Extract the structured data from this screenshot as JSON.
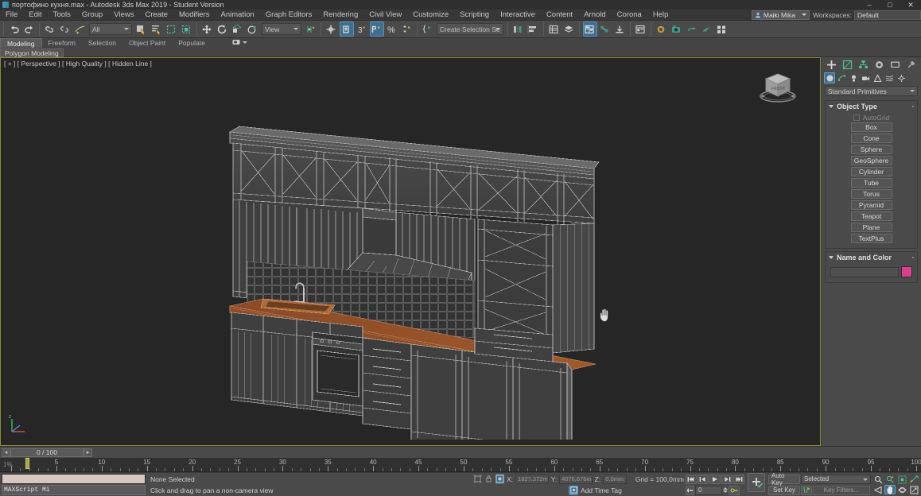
{
  "window": {
    "title": "портофино кухня.max - Autodesk 3ds Max 2019 - Student Version",
    "minimize": "–",
    "maximize": "□",
    "close": "✕"
  },
  "menu": {
    "items": [
      "File",
      "Edit",
      "Tools",
      "Group",
      "Views",
      "Create",
      "Modifiers",
      "Animation",
      "Graph Editors",
      "Rendering",
      "Civil View",
      "Customize",
      "Scripting",
      "Interactive",
      "Content",
      "Arnold",
      "Corona",
      "Help"
    ]
  },
  "account": {
    "name": "Maiki Mika"
  },
  "workspaces": {
    "label": "Workspaces:",
    "value": "Default"
  },
  "toolbar": {
    "undo": "undo-arrow",
    "redo": "redo-arrow",
    "selection_filter": "All",
    "reference_coord": "View",
    "named_selection_sets": "Create Selection Se"
  },
  "ribbon": {
    "tabs": [
      "Modeling",
      "Freeform",
      "Selection",
      "Object Paint",
      "Populate"
    ],
    "selected_tab": "Modeling",
    "subtab": "Polygon Modeling"
  },
  "viewport": {
    "label": "[ + ] [ Perspective ] [ High Quality ] [ Hidden Line ]",
    "model": "kitchen-cabinetry-wireframe"
  },
  "command_panel": {
    "tabs": [
      "create",
      "modify",
      "hierarchy",
      "motion",
      "display",
      "utilities"
    ],
    "selected_tab": "create",
    "category_buttons": [
      "geometry",
      "shapes",
      "lights",
      "cameras",
      "helpers",
      "space-warps",
      "systems"
    ],
    "selected_category": "geometry",
    "subcategory": "Standard Primitives",
    "object_type": {
      "title": "Object Type",
      "autogrid_label": "AutoGrid",
      "autogrid_checked": false,
      "buttons": [
        "Box",
        "Cone",
        "Sphere",
        "GeoSphere",
        "Cylinder",
        "Tube",
        "Torus",
        "Pyramid",
        "Teapot",
        "Plane",
        "TextPlus"
      ]
    },
    "name_and_color": {
      "title": "Name and Color",
      "name_value": "",
      "color": "#d9408c"
    }
  },
  "time_slider": {
    "frame_text": "0 / 100",
    "prev_label": "◂",
    "next_label": "▸"
  },
  "track_bar": {
    "percent_label": "1%",
    "range_start": 0,
    "range_end": 100,
    "labels": [
      5,
      10,
      15,
      20,
      25,
      30,
      35,
      40,
      45,
      50,
      55,
      60,
      65,
      70,
      75,
      80,
      85,
      90,
      95,
      100
    ]
  },
  "status_bar": {
    "maxscript_label": "MAXScript Mi",
    "selection_status": "None Selected",
    "prompt": "Click and drag to pan a non-camera view",
    "coords": {
      "x_label": "X:",
      "x_value": "1627,372m",
      "y_label": "Y:",
      "y_value": "4076,676m",
      "z_label": "Z:",
      "z_value": "0,0mm"
    },
    "grid": "Grid = 100,0mm",
    "add_time_tag": "Add Time Tag"
  },
  "animation": {
    "goto_start": "⏮",
    "prev_frame": "⏴",
    "play": "▶",
    "next_frame": "⏵",
    "goto_end": "⏭",
    "current_frame": "0",
    "auto_key": "Auto Key",
    "set_key": "Set Key",
    "key_mode_filter": "Selected",
    "key_filters": "Key Filters..."
  },
  "colors": {
    "accent": "#3f6f8f",
    "viewport_border": "#8a8a3a",
    "panel_bg": "#4a4a4a",
    "viewport_bg": "#262626",
    "name_color_swatch": "#d9408c"
  }
}
